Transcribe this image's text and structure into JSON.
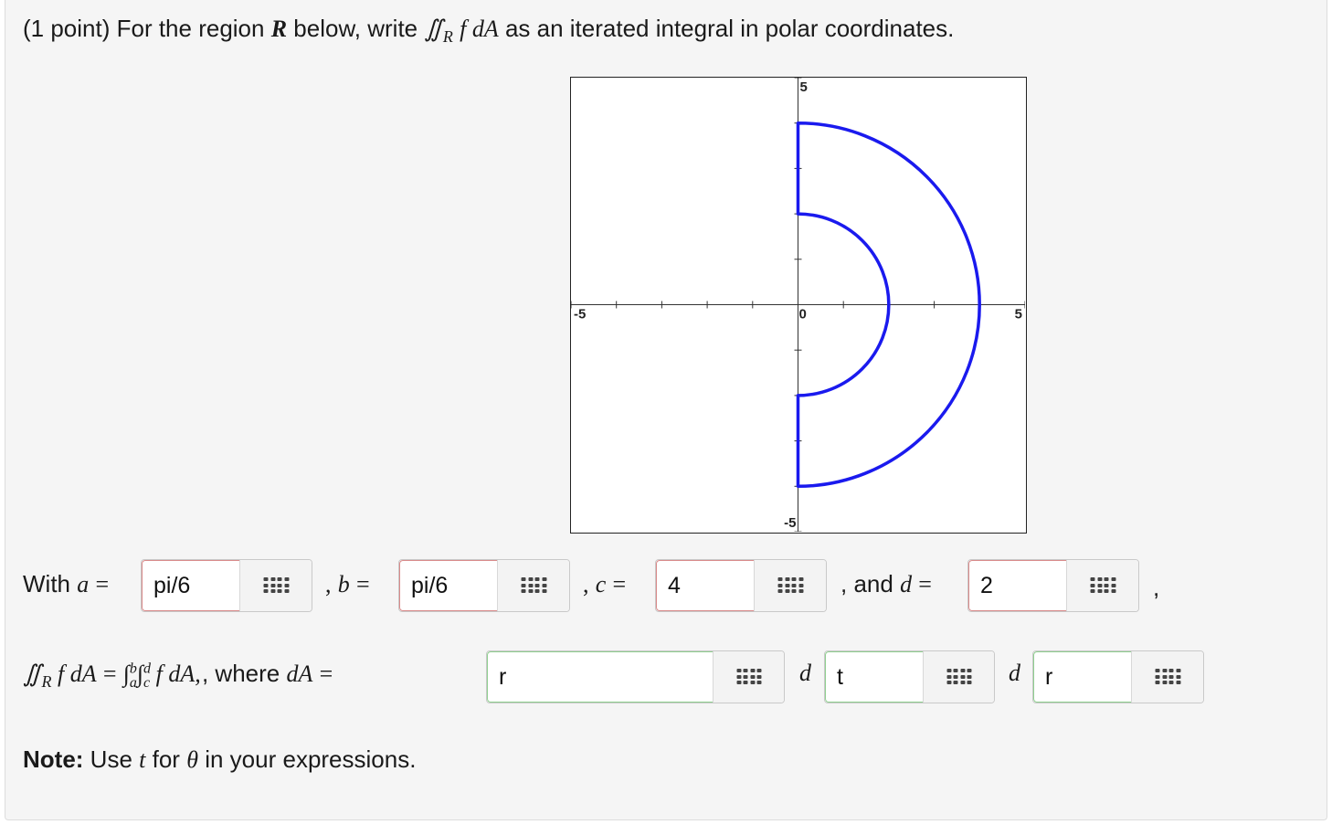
{
  "question": {
    "prefix": "(1 point) For the region",
    "region_symbol": "R",
    "text_below_write": "below, write",
    "integral_expr": "f dA",
    "suffix": "as an iterated integral in polar coordinates."
  },
  "graph": {
    "x_min_label": "-5",
    "x_max_label": "5",
    "y_max_label": "5",
    "y_min_label": "-5",
    "origin_label": "0",
    "axis_range": [
      -5,
      5
    ],
    "region": {
      "inner_radius": 2,
      "outer_radius": 4,
      "theta_range_deg": [
        -90,
        90
      ]
    },
    "region_color": "#1a1aee"
  },
  "answers": {
    "with_label": "With",
    "a_var": "a",
    "a_value": "pi/6",
    "b_var": "b",
    "b_value": "pi/6",
    "c_var": "c",
    "c_value": "4",
    "and_label": ", and",
    "d_var": "d",
    "d_value": "2",
    "equals": "=",
    "comma": ",",
    "where_label": ", where",
    "dA_value": "r",
    "d1_value": "t",
    "d2_value": "r"
  },
  "note": {
    "bold": "Note:",
    "use": "Use",
    "t_var": "t",
    "for_text": "for",
    "theta_var": "θ",
    "rest": "in your expressions."
  },
  "colors": {
    "incorrect_border": "#d98a8a",
    "correct_border": "#8fcf8f",
    "panel_bg": "#f5f5f5"
  },
  "icons": {
    "palette": "equation-editor-grid-icon"
  }
}
